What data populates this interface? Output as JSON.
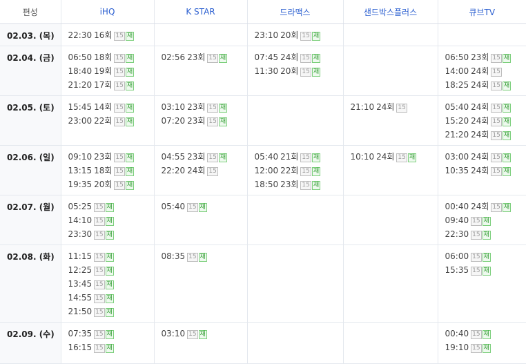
{
  "header": [
    "편성",
    "iHQ",
    "K STAR",
    "드라맥스",
    "샌드박스플러스",
    "큐브TV"
  ],
  "rows": [
    {
      "date": "02.03. (목)",
      "cells": [
        [
          {
            "time": "22:30",
            "ep": "16회",
            "age": "15",
            "re": "재"
          }
        ],
        [],
        [
          {
            "time": "23:10",
            "ep": "20회",
            "age": "15",
            "re": "재"
          }
        ],
        [],
        []
      ]
    },
    {
      "date": "02.04. (금)",
      "cells": [
        [
          {
            "time": "06:50",
            "ep": "18회",
            "age": "15",
            "re": "재"
          },
          {
            "time": "18:40",
            "ep": "19회",
            "age": "15",
            "re": "재"
          },
          {
            "time": "21:20",
            "ep": "17회",
            "age": "15",
            "re": "재"
          }
        ],
        [
          {
            "time": "02:56",
            "ep": "23회",
            "age": "15",
            "re": "재"
          }
        ],
        [
          {
            "time": "07:45",
            "ep": "24회",
            "age": "15",
            "re": "재"
          },
          {
            "time": "11:30",
            "ep": "20회",
            "age": "15",
            "re": "재"
          }
        ],
        [],
        [
          {
            "time": "06:50",
            "ep": "23회",
            "age": "15",
            "re": "재"
          },
          {
            "time": "14:00",
            "ep": "24회",
            "age": "15",
            "re": ""
          },
          {
            "time": "18:25",
            "ep": "24회",
            "age": "15",
            "re": "재"
          }
        ]
      ]
    },
    {
      "date": "02.05. (토)",
      "cells": [
        [
          {
            "time": "15:45",
            "ep": "14회",
            "age": "15",
            "re": "재"
          },
          {
            "time": "23:00",
            "ep": "22회",
            "age": "15",
            "re": "재"
          }
        ],
        [
          {
            "time": "03:10",
            "ep": "23회",
            "age": "15",
            "re": "재"
          },
          {
            "time": "07:20",
            "ep": "23회",
            "age": "15",
            "re": "재"
          }
        ],
        [],
        [
          {
            "time": "21:10",
            "ep": "24회",
            "age": "15",
            "re": ""
          }
        ],
        [
          {
            "time": "05:40",
            "ep": "24회",
            "age": "15",
            "re": "재"
          },
          {
            "time": "15:20",
            "ep": "24회",
            "age": "15",
            "re": "재"
          },
          {
            "time": "21:20",
            "ep": "24회",
            "age": "15",
            "re": "재"
          }
        ]
      ]
    },
    {
      "date": "02.06. (일)",
      "cells": [
        [
          {
            "time": "09:10",
            "ep": "23회",
            "age": "15",
            "re": "재"
          },
          {
            "time": "13:15",
            "ep": "18회",
            "age": "15",
            "re": "재"
          },
          {
            "time": "19:35",
            "ep": "20회",
            "age": "15",
            "re": "재"
          }
        ],
        [
          {
            "time": "04:55",
            "ep": "23회",
            "age": "15",
            "re": "재"
          },
          {
            "time": "22:20",
            "ep": "24회",
            "age": "15",
            "re": ""
          }
        ],
        [
          {
            "time": "05:40",
            "ep": "21회",
            "age": "15",
            "re": "재"
          },
          {
            "time": "12:00",
            "ep": "22회",
            "age": "15",
            "re": "재"
          },
          {
            "time": "18:50",
            "ep": "23회",
            "age": "15",
            "re": "재"
          }
        ],
        [
          {
            "time": "10:10",
            "ep": "24회",
            "age": "15",
            "re": "재"
          }
        ],
        [
          {
            "time": "03:00",
            "ep": "24회",
            "age": "15",
            "re": "재"
          },
          {
            "time": "10:35",
            "ep": "24회",
            "age": "15",
            "re": "재"
          }
        ]
      ]
    },
    {
      "date": "02.07. (월)",
      "cells": [
        [
          {
            "time": "05:25",
            "ep": "",
            "age": "15",
            "re": "재"
          },
          {
            "time": "14:10",
            "ep": "",
            "age": "15",
            "re": "재"
          },
          {
            "time": "23:30",
            "ep": "",
            "age": "15",
            "re": "재"
          }
        ],
        [
          {
            "time": "05:40",
            "ep": "",
            "age": "15",
            "re": "재"
          }
        ],
        [],
        [],
        [
          {
            "time": "00:40",
            "ep": "24회",
            "age": "15",
            "re": "재"
          },
          {
            "time": "09:40",
            "ep": "",
            "age": "15",
            "re": "재"
          },
          {
            "time": "22:30",
            "ep": "",
            "age": "15",
            "re": "재"
          }
        ]
      ]
    },
    {
      "date": "02.08. (화)",
      "cells": [
        [
          {
            "time": "11:15",
            "ep": "",
            "age": "15",
            "re": "재"
          },
          {
            "time": "12:25",
            "ep": "",
            "age": "15",
            "re": "재"
          },
          {
            "time": "13:45",
            "ep": "",
            "age": "15",
            "re": "재"
          },
          {
            "time": "14:55",
            "ep": "",
            "age": "15",
            "re": "재"
          },
          {
            "time": "21:50",
            "ep": "",
            "age": "15",
            "re": "재"
          }
        ],
        [
          {
            "time": "08:35",
            "ep": "",
            "age": "15",
            "re": "재"
          }
        ],
        [],
        [],
        [
          {
            "time": "06:00",
            "ep": "",
            "age": "15",
            "re": "재"
          },
          {
            "time": "15:35",
            "ep": "",
            "age": "15",
            "re": "재"
          }
        ]
      ]
    },
    {
      "date": "02.09. (수)",
      "cells": [
        [
          {
            "time": "07:35",
            "ep": "",
            "age": "15",
            "re": "재"
          },
          {
            "time": "16:15",
            "ep": "",
            "age": "15",
            "re": "재"
          }
        ],
        [
          {
            "time": "03:10",
            "ep": "",
            "age": "15",
            "re": "재"
          }
        ],
        [],
        [],
        [
          {
            "time": "00:40",
            "ep": "",
            "age": "15",
            "re": "재"
          },
          {
            "time": "19:10",
            "ep": "",
            "age": "15",
            "re": "재"
          }
        ]
      ]
    }
  ]
}
